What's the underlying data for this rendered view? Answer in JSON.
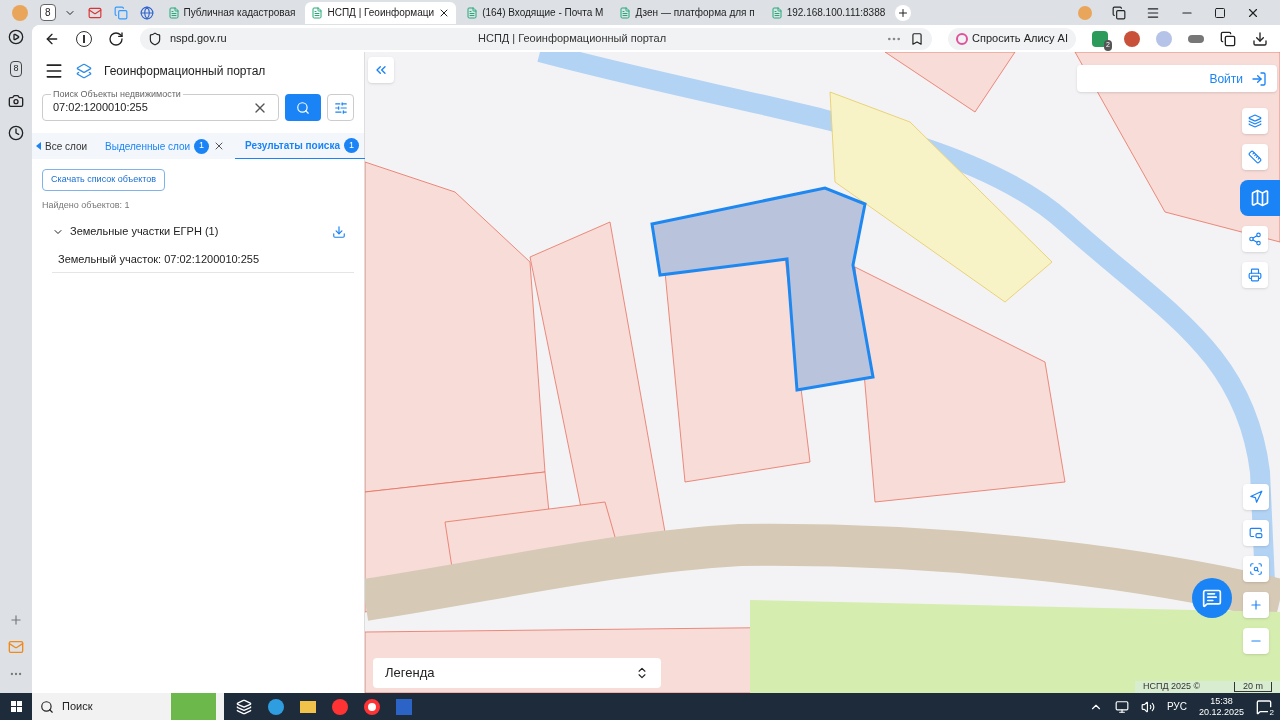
{
  "browser": {
    "tab_count": "8",
    "tabs": [
      {
        "label": "Публичная кадастровая",
        "selected": false
      },
      {
        "label": "НСПД | Геоинформаци",
        "selected": true
      },
      {
        "label": "(164) Входящие - Почта M",
        "selected": false
      },
      {
        "label": "Дзен — платформа для п",
        "selected": false
      },
      {
        "label": "192.168.100.111:8388",
        "selected": false
      }
    ],
    "address": "nspd.gov.ru",
    "page_title": "НСПД | Геоинформационный портал",
    "alice_button": "Спросить Алису AI",
    "extension_badge": "2",
    "sidebar_counter": "8"
  },
  "panel": {
    "title": "Геоинформационный портал",
    "search": {
      "label": "Поиск Объекты недвижимости",
      "value": "07:02:1200010:255"
    },
    "tabs": [
      {
        "label": "Все слои",
        "selected": false
      },
      {
        "label": "Выделенные слои",
        "badge": "1",
        "selected": false
      },
      {
        "label": "Результаты поиска",
        "badge": "1",
        "selected": true
      }
    ],
    "download_button": "Скачать список объектов",
    "found": "Найдено объектов: 1",
    "groups": [
      {
        "label": "Земельные участки ЕГРН (1)",
        "expanded": true,
        "items": [
          "Земельный участок: 07:02:1200010:255"
        ]
      }
    ]
  },
  "map": {
    "login": "Войти",
    "legend": "Легенда",
    "attribution": "НСПД 2025 ©",
    "scale": "20 m"
  },
  "taskbar": {
    "search": "Поиск",
    "language": "РУС",
    "time": "15:38",
    "date": "20.12.2025",
    "notifications": "2"
  }
}
